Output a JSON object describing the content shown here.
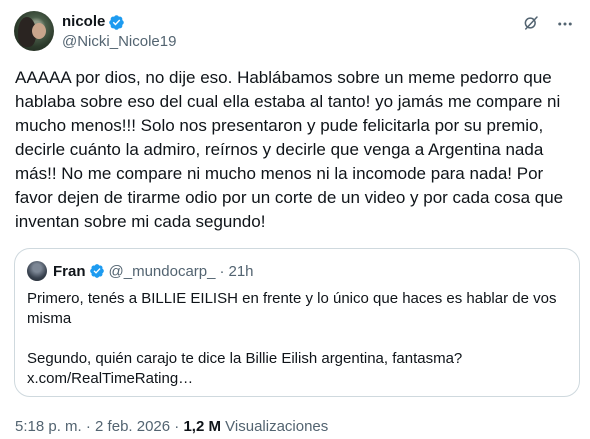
{
  "author": {
    "display_name": "nicole",
    "handle": "@Nicki_Nicole19",
    "avatar": "user-avatar"
  },
  "icons": {
    "verified": "verified-badge-icon",
    "grok": "grok-icon",
    "more": "more-options-icon",
    "verified_color": "#1d9bf0"
  },
  "tweet": {
    "text": "AAAAA por dios, no dije eso. Hablábamos sobre un meme pedorro que hablaba sobre eso del cual ella estaba al tanto! yo jamás me compare ni mucho menos!!! Solo nos presentaron y pude felicitarla por su premio, decirle cuánto la admiro, reírnos y decirle que venga a Argentina nada más!! No me compare ni mucho menos ni la incomode para nada! Por favor dejen de tirarme odio por un corte de un video y por cada cosa que inventan sobre mi cada segundo!"
  },
  "quote": {
    "display_name": "Fran",
    "handle": "@_mundocarp_",
    "separator": "·",
    "time": "21h",
    "para1": "Primero, tenés a BILLIE EILISH en frente y lo único que haces es hablar de vos misma",
    "para2_line1": "Segundo, quién carajo te dice la Billie Eilish argentina, fantasma?",
    "para2_line2": "x.com/RealTimeRating…"
  },
  "meta": {
    "time": "5:18 p. m.",
    "sep1": "·",
    "date": "2 feb. 2026",
    "sep2": "·",
    "views_count": "1,2 M",
    "views_label": "Visualizaciones"
  }
}
